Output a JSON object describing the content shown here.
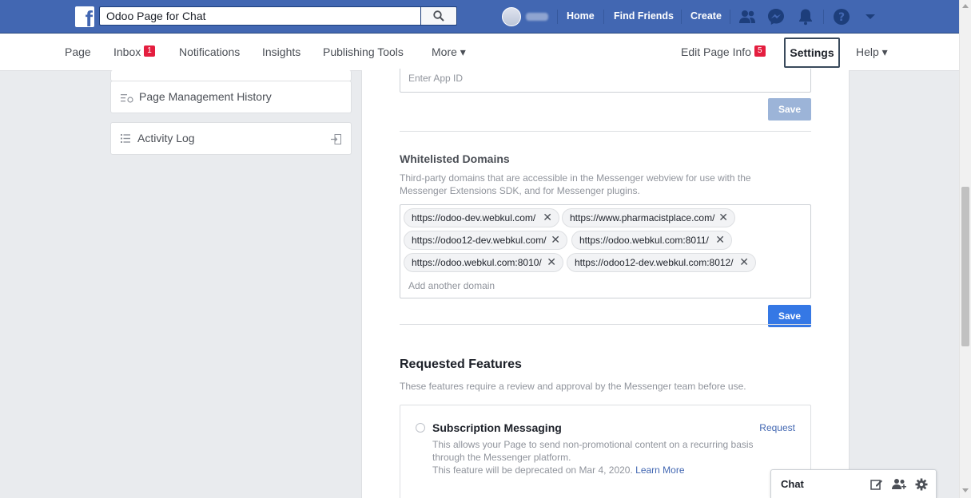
{
  "topbar": {
    "search_value": "Odoo Page for Chat",
    "nav_links": [
      "Home",
      "Find Friends",
      "Create"
    ],
    "colors": {
      "bar": "#4267b2",
      "badge": "#e41e3f",
      "link": "#4267b2"
    }
  },
  "page_nav": {
    "page": "Page",
    "inbox": "Inbox",
    "inbox_badge": "1",
    "notifications": "Notifications",
    "insights": "Insights",
    "publishing_tools": "Publishing Tools",
    "more": "More ▾",
    "edit_page_info": "Edit Page Info",
    "edit_badge": "5",
    "settings": "Settings",
    "help": "Help ▾"
  },
  "sidebar": {
    "items": [
      {
        "label": "Page Management History",
        "icon": "history-list-icon"
      },
      {
        "label": "Activity Log",
        "icon": "list-icon"
      }
    ]
  },
  "app_id": {
    "placeholder": "Enter App ID",
    "save_label": "Save"
  },
  "whitelisted": {
    "title": "Whitelisted Domains",
    "description": "Third-party domains that are accessible in the Messenger webview for use with the Messenger Extensions SDK, and for Messenger plugins.",
    "domains": [
      "https://odoo-dev.webkul.com/",
      "https://www.pharmacistplace.com/",
      "https://odoo12-dev.webkul.com/",
      "https://odoo.webkul.com:8011/",
      "https://odoo.webkul.com:8010/",
      "https://odoo12-dev.webkul.com:8012/"
    ],
    "add_placeholder": "Add another domain",
    "save_label": "Save"
  },
  "requested": {
    "title": "Requested Features",
    "description": "These features require a review and approval by the Messenger team before use.",
    "feature_title": "Subscription Messaging",
    "feature_action": "Request",
    "feature_desc": "This allows your Page to send non-promotional content on a recurring basis through the Messenger platform.",
    "feature_deprecation": "This feature will be deprecated on Mar 4, 2020.",
    "learn_more": "Learn More"
  },
  "chat": {
    "label": "Chat"
  }
}
